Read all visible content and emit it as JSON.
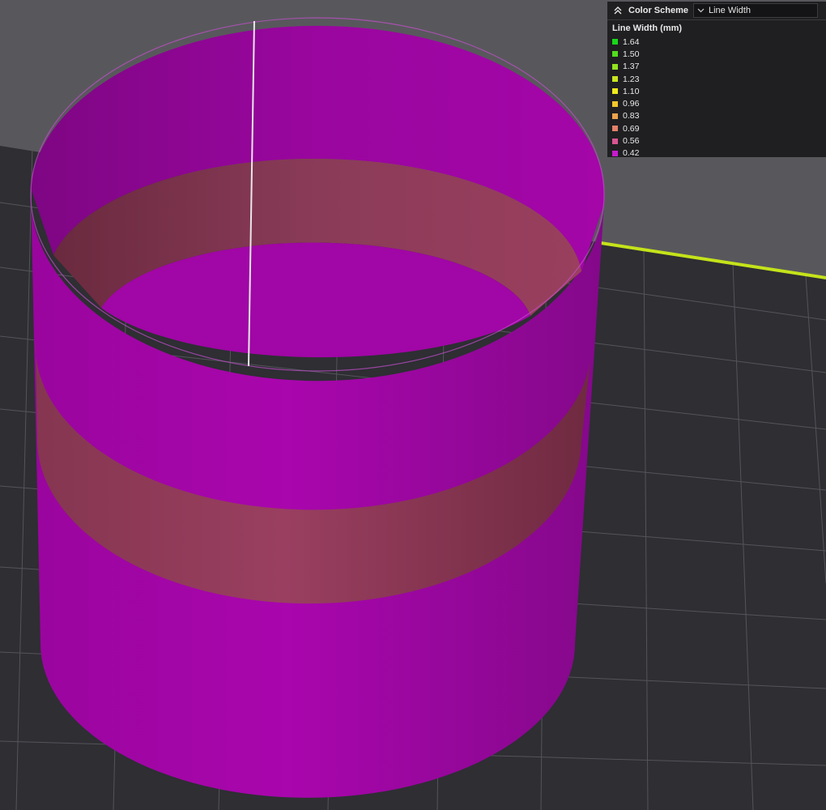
{
  "viewer": {
    "colors": {
      "background_top": "#58585c",
      "bed": "#2e2e33",
      "grid_line": "#55555b",
      "bed_edge": "#c5e31a",
      "seam": "#e8e8e8",
      "wall_main": "#a406a8",
      "wall_band": "#8d3b55"
    }
  },
  "legend": {
    "collapse_icon": "chevron-up-double-icon",
    "color_scheme_label": "Color Scheme",
    "selected_scheme": "Line Width",
    "title": "Line Width (mm)",
    "items": [
      {
        "value": "1.64",
        "color": "#18d81a"
      },
      {
        "value": "1.50",
        "color": "#52dd1c"
      },
      {
        "value": "1.37",
        "color": "#93e21f"
      },
      {
        "value": "1.23",
        "color": "#c9e51f"
      },
      {
        "value": "1.10",
        "color": "#f1ea1d"
      },
      {
        "value": "0.96",
        "color": "#f0c62c"
      },
      {
        "value": "0.83",
        "color": "#eba34e"
      },
      {
        "value": "0.69",
        "color": "#e3806b"
      },
      {
        "value": "0.56",
        "color": "#d95591"
      },
      {
        "value": "0.42",
        "color": "#c81ad0"
      }
    ]
  }
}
